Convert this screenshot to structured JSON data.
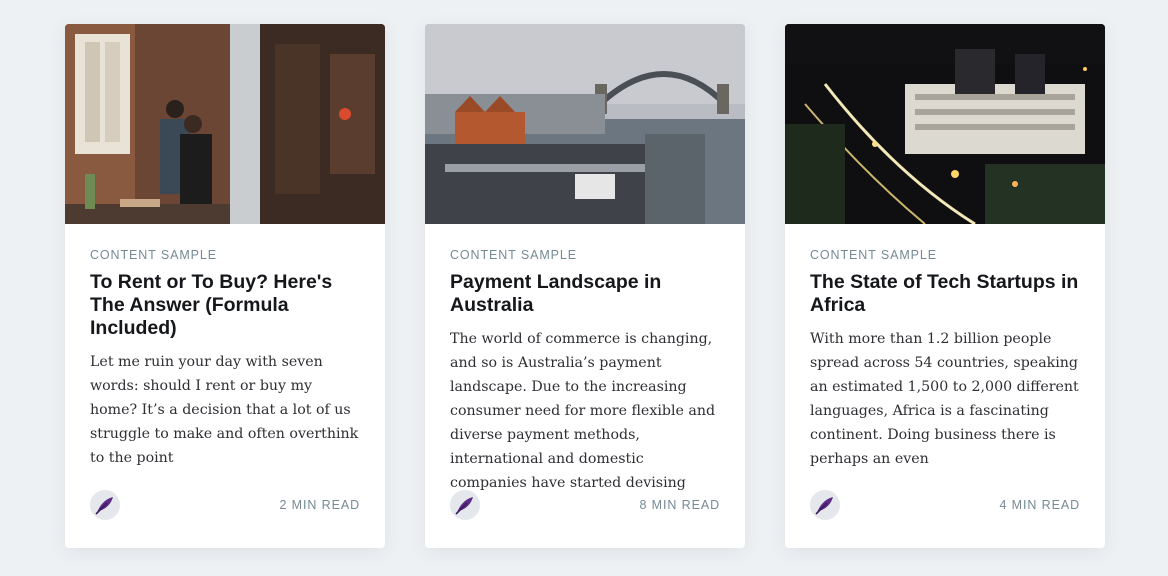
{
  "cards": [
    {
      "tag": "CONTENT SAMPLE",
      "title": "To Rent or To Buy? Here's The Answer (Formula Included)",
      "excerpt": "Let me ruin your day with seven words: should I rent or buy my home? It’s a decision that a lot of us struggle to make and often overthink to the point",
      "reading_time": "2 MIN READ",
      "image_icon": "couple-kitchen-photo",
      "author_icon": "feather-avatar-icon"
    },
    {
      "tag": "CONTENT SAMPLE",
      "title": "Payment Landscape in Australia",
      "excerpt": "The world of commerce is changing, and so is Australia’s payment landscape. Due to the increasing consumer need for more flexible and diverse payment methods, international and domestic companies have started devising",
      "reading_time": "8 MIN READ",
      "image_icon": "sydney-harbour-bridge-photo",
      "author_icon": "feather-avatar-icon"
    },
    {
      "tag": "CONTENT SAMPLE",
      "title": "The State of Tech Startups in Africa",
      "excerpt": "With more than 1.2 billion people spread across 54 countries, speaking an estimated 1,500 to 2,000 different languages, Africa is a fascinating continent. Doing business there is perhaps an even",
      "reading_time": "4 MIN READ",
      "image_icon": "city-night-photo",
      "author_icon": "feather-avatar-icon"
    }
  ],
  "colors": {
    "background": "#eef1f4",
    "card": "#ffffff",
    "meta_text": "#738a94",
    "title_text": "#15171a",
    "body_text": "#2e2f33",
    "avatar_feather": "#5b2a86"
  }
}
